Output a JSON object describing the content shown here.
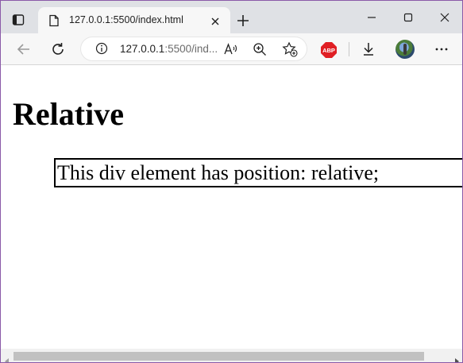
{
  "tab": {
    "title": "127.0.0.1:5500/index.html"
  },
  "address_bar": {
    "url_host": "127.0.0.1",
    "url_rest": ":5500/ind..."
  },
  "extensions": {
    "adblock_label": "ABP"
  },
  "page": {
    "heading": "Relative",
    "box_text": "This div element has position: relative;"
  },
  "colors": {
    "window_border": "#8a5aa8",
    "tabstrip_bg": "#dfe1e5",
    "toolbar_bg": "#f7f7f7",
    "adblock_red": "#e01f24"
  },
  "icons": [
    "tab-actions-icon",
    "page-icon",
    "close-tab-icon",
    "new-tab-icon",
    "minimize-icon",
    "maximize-icon",
    "close-window-icon",
    "back-icon",
    "refresh-icon",
    "info-icon",
    "read-aloud-icon",
    "zoom-icon",
    "add-favorite-icon",
    "adblock-icon",
    "download-icon",
    "profile-avatar",
    "more-icon",
    "scroll-left-icon",
    "scroll-right-icon"
  ]
}
